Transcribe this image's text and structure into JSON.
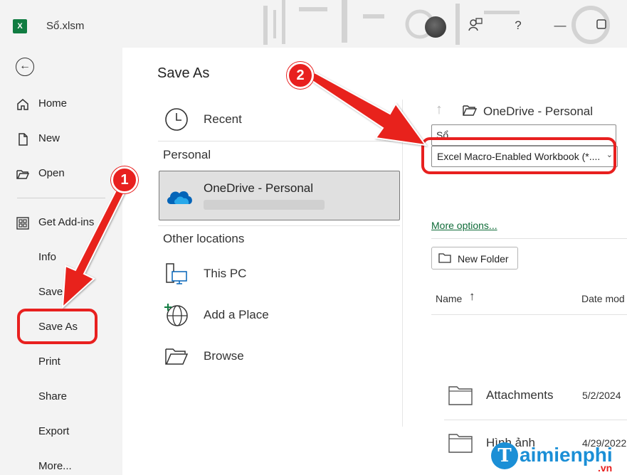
{
  "titlebar": {
    "app_icon": "excel-icon",
    "app_icon_letter": "X",
    "filename": "Sổ.xlsm",
    "icons": [
      "avatar",
      "collaborate-icon",
      "help-icon",
      "minimize-icon",
      "maximize-icon"
    ],
    "help_glyph": "?",
    "minimize_glyph": "—"
  },
  "nav": {
    "back_icon": "back-arrow-icon",
    "back_glyph": "←",
    "items": [
      {
        "label": "Home",
        "icon": "home-icon"
      },
      {
        "label": "New",
        "icon": "new-document-icon"
      },
      {
        "label": "Open",
        "icon": "open-folder-icon"
      },
      {
        "label": "Get Add-ins",
        "icon": "add-ins-icon"
      },
      {
        "label": "Info"
      },
      {
        "label": "Save"
      },
      {
        "label": "Save As",
        "highlighted": true
      },
      {
        "label": "Print"
      },
      {
        "label": "Share"
      },
      {
        "label": "Export"
      },
      {
        "label": "More..."
      }
    ]
  },
  "saveas": {
    "heading": "Save As",
    "recent_label": "Recent",
    "personal_section": "Personal",
    "onedrive_label": "OneDrive - Personal",
    "other_section": "Other locations",
    "this_pc_label": "This PC",
    "add_place_label": "Add a Place",
    "browse_label": "Browse"
  },
  "rightpanel": {
    "path_label": "OneDrive - Personal",
    "filename_value": "Sổ",
    "file_type_value": "Excel Macro-Enabled Workbook (*....",
    "more_options": "More options...",
    "new_folder_label": "New Folder",
    "columns": {
      "name": "Name",
      "name_sort_glyph": "↑",
      "date": "Date mod"
    },
    "files": [
      {
        "name": "Attachments",
        "date": "5/2/2024"
      },
      {
        "name": "Hình ảnh",
        "date": "4/29/2022"
      }
    ]
  },
  "annotations": {
    "badge1": "1",
    "badge2": "2",
    "accent_color": "#e8201f"
  },
  "watermark": {
    "letter": "T",
    "text": "aimienphi",
    "suffix": ".vn"
  },
  "colors": {
    "excel_green": "#107c41",
    "link_green": "#0f6b38",
    "onedrive_blue": "#0364b8",
    "highlight_red": "#e8201f"
  }
}
